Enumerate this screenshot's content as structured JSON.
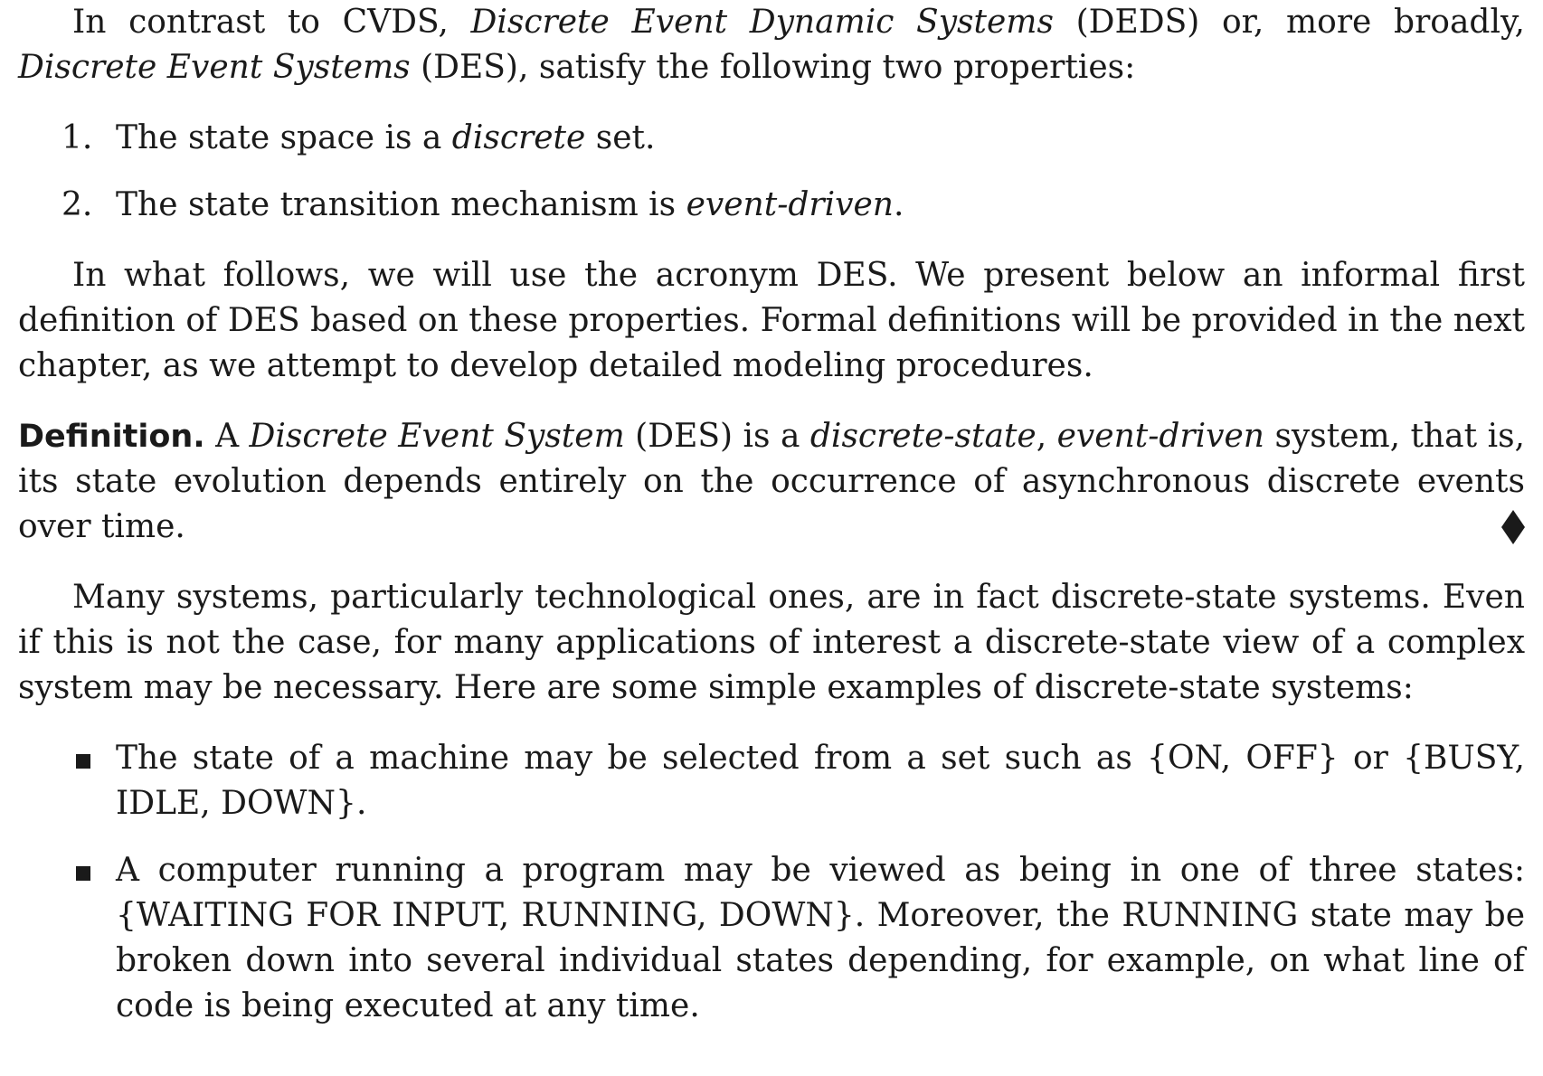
{
  "intro": {
    "t1": "In contrast to CVDS, ",
    "i1": "Discrete Event Dynamic Systems",
    "t2": " (DEDS) or, more broadly, ",
    "i2": "Discrete Event Systems",
    "t3": " (DES), satisfy the following two properties:"
  },
  "properties": [
    {
      "num": "1.",
      "t1": "The state space is a ",
      "i1": "discrete",
      "t2": " set."
    },
    {
      "num": "2.",
      "t1": "The state transition mechanism is ",
      "i1": "event-driven",
      "t2": "."
    }
  ],
  "follow_para": "In what follows, we will use the acronym DES. We present below an informal first definition of DES based on these properties. Formal definitions will be provided in the next chapter, as we attempt to develop detailed modeling procedures.",
  "definition": {
    "label": "Definition.",
    "t1": " A ",
    "i1": "Discrete Event System",
    "t2": " (DES) is a ",
    "i2": "discrete-state",
    "t3": ", ",
    "i3": "event-driven",
    "t4": " system, that is, its state evolution depends entirely on the occurrence of asynchronous discrete events over time.",
    "end_mark_icon": "diamond-icon"
  },
  "many_para": "Many systems, particularly technological ones, are in fact discrete-state systems. Even if this is not the case, for many applications of interest a discrete-state view of a complex system may be necessary. Here are some simple examples of discrete-state systems:",
  "examples": [
    {
      "text": "The state of a machine may be selected from a set such as {ON, OFF} or {BUSY, IDLE, DOWN}."
    },
    {
      "text": "A computer running a program may be viewed as being in one of three states: {WAITING FOR INPUT, RUNNING, DOWN}. Moreover, the RUNNING state may be broken down into several individual states depending, for example, on what line of code is being executed at any time."
    }
  ],
  "colors": {
    "text": "#1a1a1a",
    "background": "#ffffff"
  }
}
